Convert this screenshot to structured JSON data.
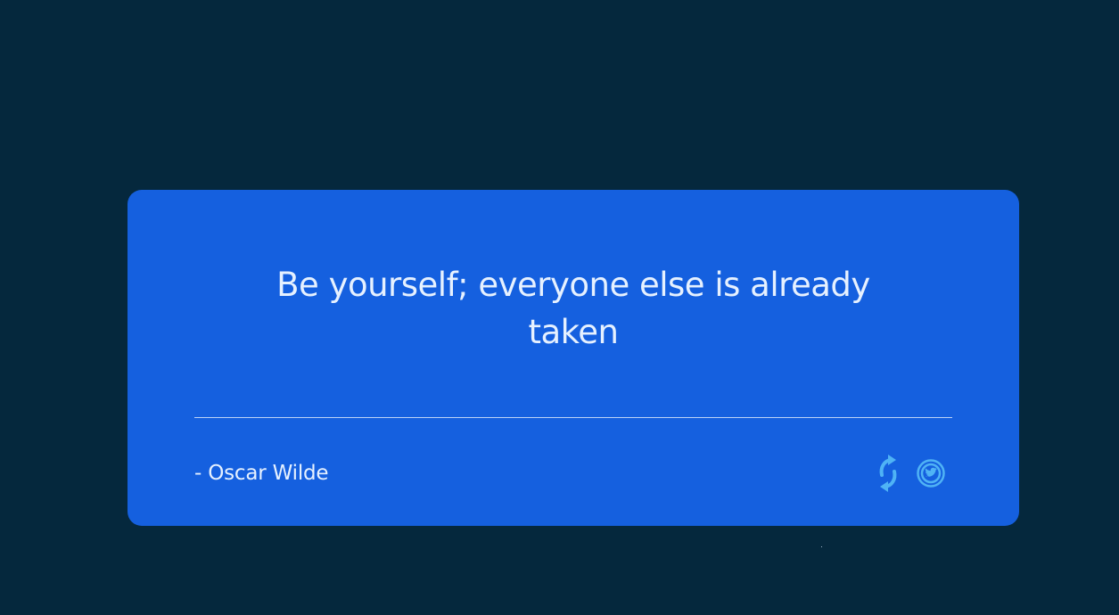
{
  "quote": {
    "text": "Be yourself; everyone else is already taken",
    "author": "- Oscar Wilde"
  },
  "actions": [
    {
      "icon": "refresh-icon",
      "role": "new quote"
    },
    {
      "icon": "twitter-icon",
      "role": "tweet quote"
    }
  ],
  "colors": {
    "background": "#05283d",
    "card": "#1560df",
    "text": "#e6f1ff",
    "icon": "#4fb3f5"
  }
}
